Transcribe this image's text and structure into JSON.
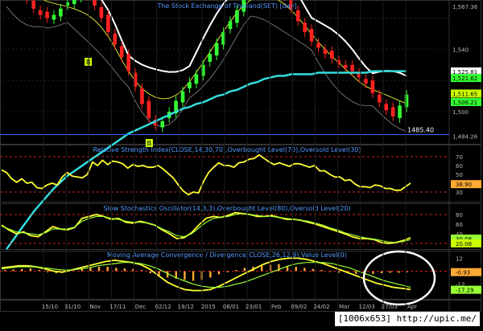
{
  "colors": {
    "background": "#000000",
    "price_up": "#33ff33",
    "price_down": "#ff2222",
    "ma_line": "#33dddd",
    "bollinger": "#ffffff",
    "indicator_line": "#ffff33",
    "signal_line": "#99ff33",
    "level_line": "#cc2222",
    "label_text": "#5599ff",
    "highlight_circle": "#ffffff",
    "tag_box": "#ccff00"
  },
  "watermark": "[1006x653] http://upic.me/",
  "chart_data": [
    {
      "type": "candlestick",
      "title": "The Stock Exchange of Thailand(SET) [day]",
      "ylim": [
        1480,
        1570
      ],
      "y_labels": [
        "1,567.36",
        "1,540",
        "1,525.81",
        "1,521.62",
        "1,511.65",
        "1,506.21",
        "1,500",
        "1,484.26"
      ],
      "level_labels": [
        "1485.40"
      ],
      "level_lines": [
        1485.4
      ],
      "signal_markers": [
        "B",
        "B"
      ],
      "close_series": [
        1598,
        1588,
        1579,
        1572,
        1566,
        1562,
        1560,
        1562,
        1566,
        1570,
        1574,
        1578,
        1574,
        1568,
        1560,
        1551,
        1543,
        1535,
        1526,
        1516,
        1505,
        1496,
        1491,
        1494,
        1500,
        1507,
        1513,
        1519,
        1524,
        1530,
        1537,
        1544,
        1551,
        1558,
        1565,
        1572,
        1580,
        1585,
        1589,
        1587,
        1582,
        1574,
        1566,
        1558,
        1551,
        1545,
        1541,
        1537,
        1534,
        1531,
        1528,
        1526,
        1522,
        1518,
        1512,
        1506,
        1501,
        1497,
        1504,
        1511
      ],
      "ma_series": [
        1412,
        1418,
        1424,
        1430,
        1436,
        1441,
        1446,
        1451,
        1455,
        1459,
        1462,
        1465,
        1468,
        1471,
        1474,
        1477,
        1480,
        1483,
        1486,
        1488,
        1490,
        1492,
        1494,
        1496,
        1498,
        1500,
        1502,
        1503,
        1505,
        1506,
        1508,
        1510,
        1511,
        1513,
        1514,
        1516,
        1518,
        1519,
        1521,
        1522,
        1523,
        1523,
        1524,
        1524,
        1524,
        1524,
        1525,
        1525,
        1525,
        1525,
        1525,
        1525,
        1525,
        1525,
        1526,
        1526,
        1526,
        1526,
        1526,
        1526
      ],
      "x_tick_labels": [
        "15/10",
        "31/10",
        "Nov",
        "17/11",
        "Dec",
        "02/12",
        "19/12",
        "2015",
        "08/01",
        "23/01",
        "Feb",
        "09/02",
        "24/02",
        "Mar",
        "12/03",
        "27/03",
        "Apr"
      ]
    },
    {
      "type": "line",
      "title": "Relative Strength Index(CLOSE,14,30,70),Overbought Level(70),Oversold Level(30)",
      "ylim": [
        20,
        80
      ],
      "levels": [
        70,
        30
      ],
      "y_labels": [
        "70",
        "60",
        "50",
        "40",
        "30",
        "38.90"
      ],
      "series": [
        {
          "values": [
            55,
            52,
            45,
            41,
            45,
            40,
            41,
            35,
            34,
            38,
            40,
            38,
            47,
            52,
            48,
            47,
            46,
            50,
            64,
            60,
            66,
            61,
            65,
            64,
            62,
            57,
            61,
            59,
            60,
            58,
            58,
            60,
            56,
            51,
            46,
            38,
            31,
            27,
            30,
            29,
            42,
            52,
            58,
            63,
            60,
            60,
            58,
            63,
            64,
            67,
            68,
            72,
            68,
            64,
            61,
            63,
            61,
            59,
            62,
            62,
            60,
            58,
            60,
            54,
            54,
            50,
            47,
            47,
            43,
            44,
            39,
            36,
            36,
            35,
            38,
            37,
            34,
            34,
            32,
            32,
            36,
            40
          ]
        }
      ]
    },
    {
      "type": "line",
      "title": "Slow Stochastics Oscillator(14,3,3),Overbought Level(80),Oversold Level(20)",
      "ylim": [
        10,
        95
      ],
      "levels": [
        80,
        20
      ],
      "y_labels": [
        "80",
        "60",
        "40",
        "20",
        "30.08",
        "20.08"
      ],
      "series": [
        {
          "values": [
            58,
            48,
            40,
            44,
            36,
            34,
            44,
            55,
            50,
            48,
            53,
            72,
            76,
            80,
            76,
            70,
            72,
            64,
            62,
            66,
            62,
            58,
            48,
            40,
            30,
            32,
            42,
            58,
            72,
            76,
            74,
            78,
            84,
            82,
            80,
            76,
            76,
            78,
            74,
            70,
            70,
            68,
            64,
            60,
            55,
            50,
            45,
            40,
            34,
            30,
            30,
            28,
            22,
            20,
            22,
            26,
            32
          ]
        },
        {
          "values": [
            56,
            50,
            44,
            42,
            40,
            38,
            42,
            50,
            50,
            50,
            54,
            66,
            72,
            76,
            76,
            72,
            70,
            66,
            64,
            64,
            62,
            58,
            50,
            44,
            36,
            34,
            40,
            52,
            64,
            72,
            74,
            76,
            80,
            82,
            80,
            78,
            76,
            76,
            74,
            72,
            70,
            68,
            66,
            62,
            58,
            52,
            48,
            42,
            38,
            34,
            31,
            29,
            26,
            23,
            22,
            24,
            28
          ]
        }
      ]
    },
    {
      "type": "bar+line",
      "title": "Moving Average Convergence / Divergence(CLOSE,26,12,9),Value Level(0)",
      "ylim": [
        -25,
        16
      ],
      "levels": [
        0
      ],
      "y_labels": [
        "12",
        "0",
        "-0.93",
        "-12",
        "-17.29"
      ],
      "histogram": [
        1,
        1.5,
        2,
        2.5,
        1,
        -1,
        -2,
        -1,
        0.5,
        2,
        3,
        4,
        4,
        3,
        2.5,
        2,
        1,
        -2,
        -4,
        -6,
        -7,
        -8,
        -9,
        -8,
        -6,
        -3,
        -1,
        1,
        3,
        4,
        5,
        6,
        6.5,
        5,
        4,
        3,
        2,
        1,
        -0.5,
        -1.5,
        -2,
        -2.5,
        -3,
        -2.5,
        -2,
        -1.5,
        -1.5,
        -1
      ],
      "series": [
        {
          "values": [
            3,
            4,
            5,
            5,
            4,
            2,
            0,
            -1,
            1,
            3,
            5,
            7,
            9,
            10,
            9,
            8,
            6,
            2,
            -4,
            -10,
            -14,
            -17,
            -18,
            -18,
            -17,
            -14,
            -10,
            -6,
            -2,
            2,
            6,
            9,
            11,
            12,
            12,
            11,
            9,
            7,
            4,
            1,
            -2,
            -5,
            -8,
            -11,
            -13,
            -15,
            -16,
            -17
          ]
        },
        {
          "values": [
            2,
            3,
            4,
            4,
            4,
            3,
            2,
            1,
            1,
            2,
            3,
            5,
            6,
            7,
            8,
            8,
            7,
            5,
            2,
            -2,
            -6,
            -9,
            -12,
            -14,
            -15,
            -15,
            -14,
            -12,
            -10,
            -7,
            -4,
            -1,
            2,
            5,
            7,
            8,
            8,
            8,
            7,
            5,
            3,
            0,
            -3,
            -6,
            -9,
            -11,
            -13,
            -15
          ]
        }
      ]
    }
  ]
}
